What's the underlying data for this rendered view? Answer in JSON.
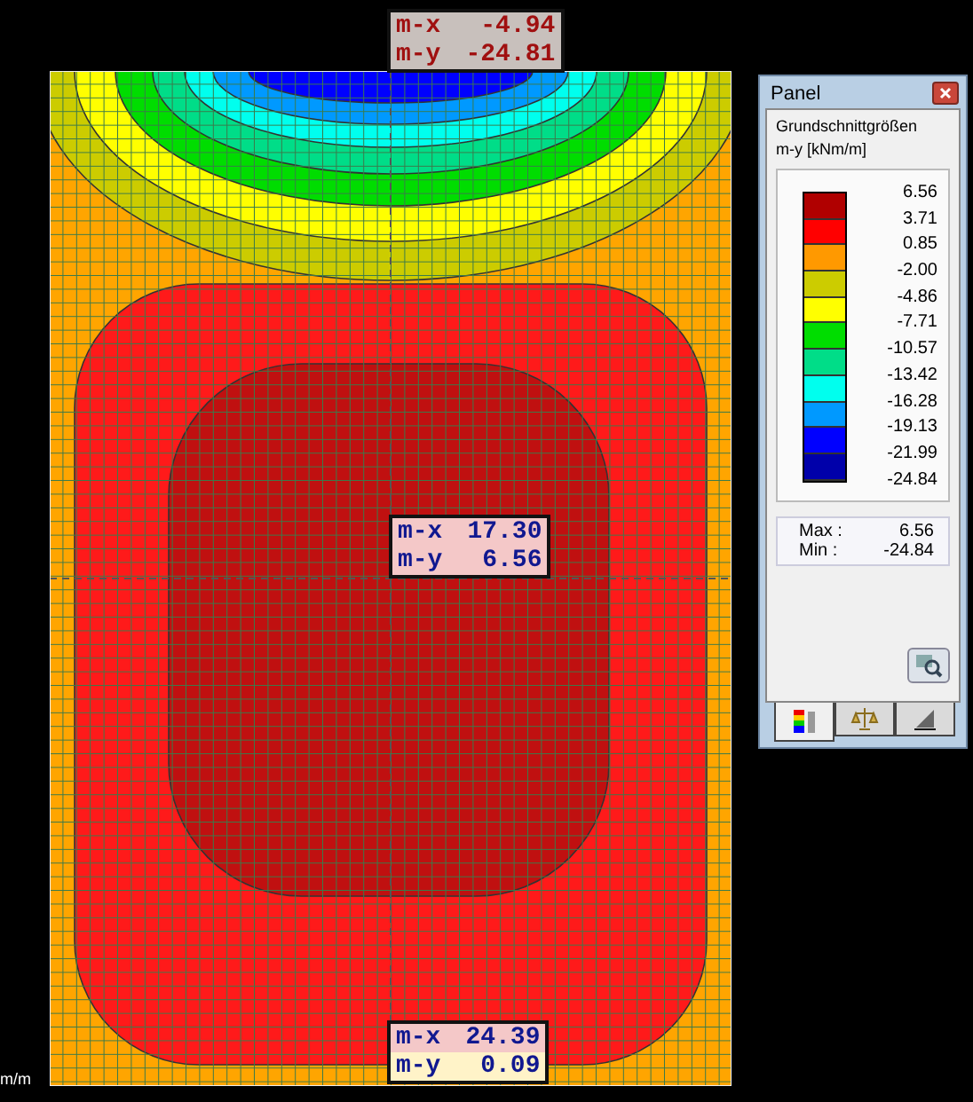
{
  "plot": {
    "axis_label": "m/m",
    "labels": [
      {
        "kind": "muted",
        "rows": [
          {
            "name": "m-x",
            "value": "-4.94"
          },
          {
            "name": "m-y",
            "value": "-24.81"
          }
        ]
      },
      {
        "kind": "normal",
        "rows": [
          {
            "name": "m-x",
            "value": "17.30"
          },
          {
            "name": "m-y",
            "value": "6.56"
          }
        ]
      },
      {
        "kind": "normal",
        "rows": [
          {
            "name": "m-x",
            "value": "24.39"
          },
          {
            "name": "m-y",
            "value": "0.09"
          }
        ]
      }
    ]
  },
  "panel": {
    "title": "Panel",
    "heading": "Grundschnittgrößen",
    "unit": "m-y [kNm/m]",
    "bands": [
      {
        "color": "#b00000"
      },
      {
        "color": "#ff0000"
      },
      {
        "color": "#ff9900"
      },
      {
        "color": "#cccc00"
      },
      {
        "color": "#ffff00"
      },
      {
        "color": "#00dd00"
      },
      {
        "color": "#00dd88"
      },
      {
        "color": "#00ffee"
      },
      {
        "color": "#0099ff"
      },
      {
        "color": "#0000ff"
      },
      {
        "color": "#0000aa"
      }
    ],
    "ticks": [
      "6.56",
      "3.71",
      "0.85",
      "-2.00",
      "-4.86",
      "-7.71",
      "-10.57",
      "-13.42",
      "-16.28",
      "-19.13",
      "-21.99",
      "-24.84"
    ],
    "max_label": "Max :",
    "max": "6.56",
    "min_label": "Min :",
    "min": "-24.84",
    "tabs": [
      {
        "kind": "legend",
        "selected": true
      },
      {
        "kind": "balance",
        "selected": false
      },
      {
        "kind": "settings",
        "selected": false
      }
    ]
  }
}
